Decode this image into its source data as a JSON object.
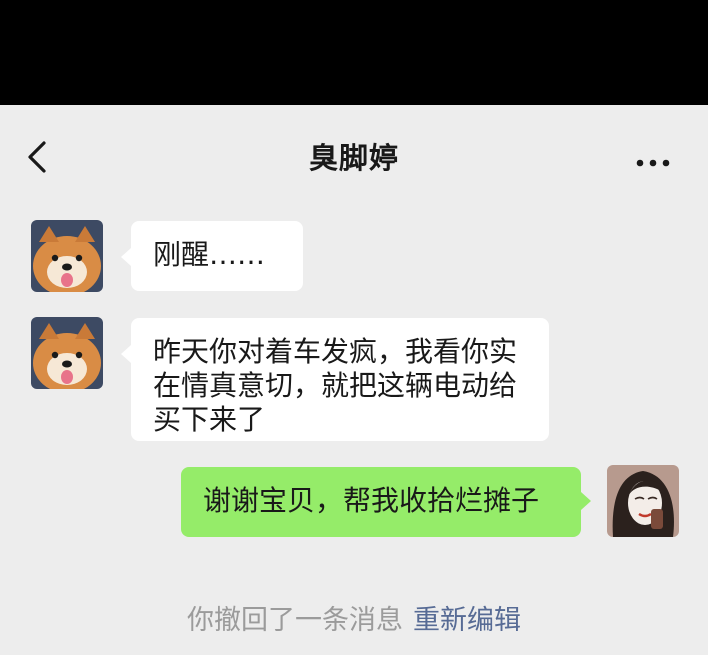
{
  "header": {
    "title": "臭脚婷",
    "back_icon": "chevron-left-icon",
    "more_icon": "more-horizontal-icon"
  },
  "messages": [
    {
      "side": "incoming",
      "text": "刚醒……"
    },
    {
      "side": "incoming",
      "text": "昨天你对着车发疯，我看你实在情真意切，就把这辆电动给买下来了"
    },
    {
      "side": "outgoing",
      "text": "谢谢宝贝，帮我收拾烂摊子"
    }
  ],
  "system": {
    "recall_text": "你撤回了一条消息",
    "reedit_label": "重新编辑"
  },
  "colors": {
    "background": "#ededed",
    "incoming_bubble": "#ffffff",
    "outgoing_bubble": "#95ec69",
    "link": "#576b95",
    "system_text": "#9b9b9b"
  }
}
